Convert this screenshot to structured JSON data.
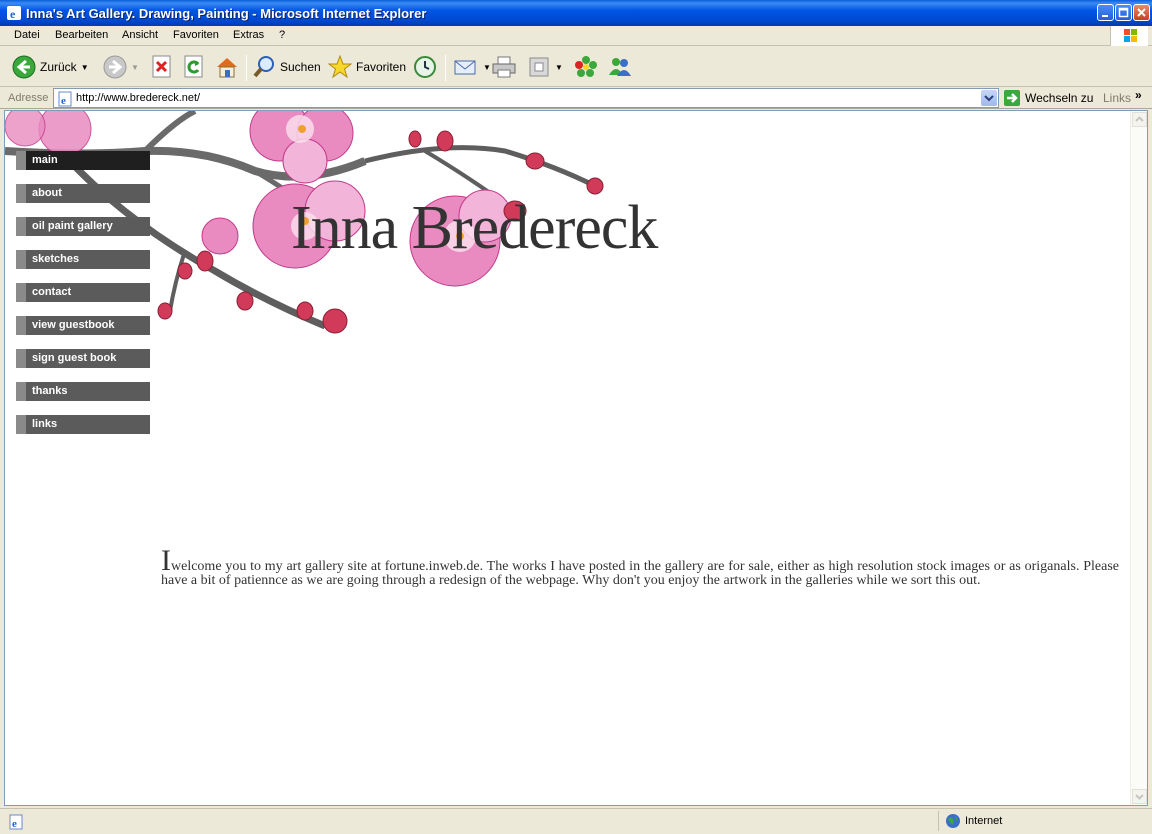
{
  "window": {
    "title": "Inna's Art Gallery. Drawing, Painting - Microsoft Internet Explorer"
  },
  "menu": {
    "items": [
      "Datei",
      "Bearbeiten",
      "Ansicht",
      "Favoriten",
      "Extras",
      "?"
    ]
  },
  "toolbar": {
    "back_label": "Zurück",
    "search_label": "Suchen",
    "favorites_label": "Favoriten"
  },
  "address": {
    "label": "Adresse",
    "url": "http://www.bredereck.net/",
    "go_label": "Wechseln zu",
    "links_label": "Links"
  },
  "page": {
    "title": "Inna Bredereck",
    "nav": [
      "main",
      "about",
      "oil paint gallery",
      "sketches",
      "contact",
      "view guestbook",
      "sign guest book",
      "thanks",
      "links"
    ],
    "active_nav": "main",
    "welcome_cap": "I",
    "welcome_text": "welcome you to my art gallery site at fortune.inweb.de. The works I have posted in the gallery are for sale, either as high resolution stock images or as origanals. Please have a bit of patiennce as we are going through a redesign of the webpage. Why don't you enjoy the artwork in the galleries while we sort this out."
  },
  "status": {
    "zone": "Internet"
  },
  "colors": {
    "nav_bg": "#5b5b5b",
    "nav_active": "#1f1f1f",
    "blossom": "#e0529c"
  }
}
